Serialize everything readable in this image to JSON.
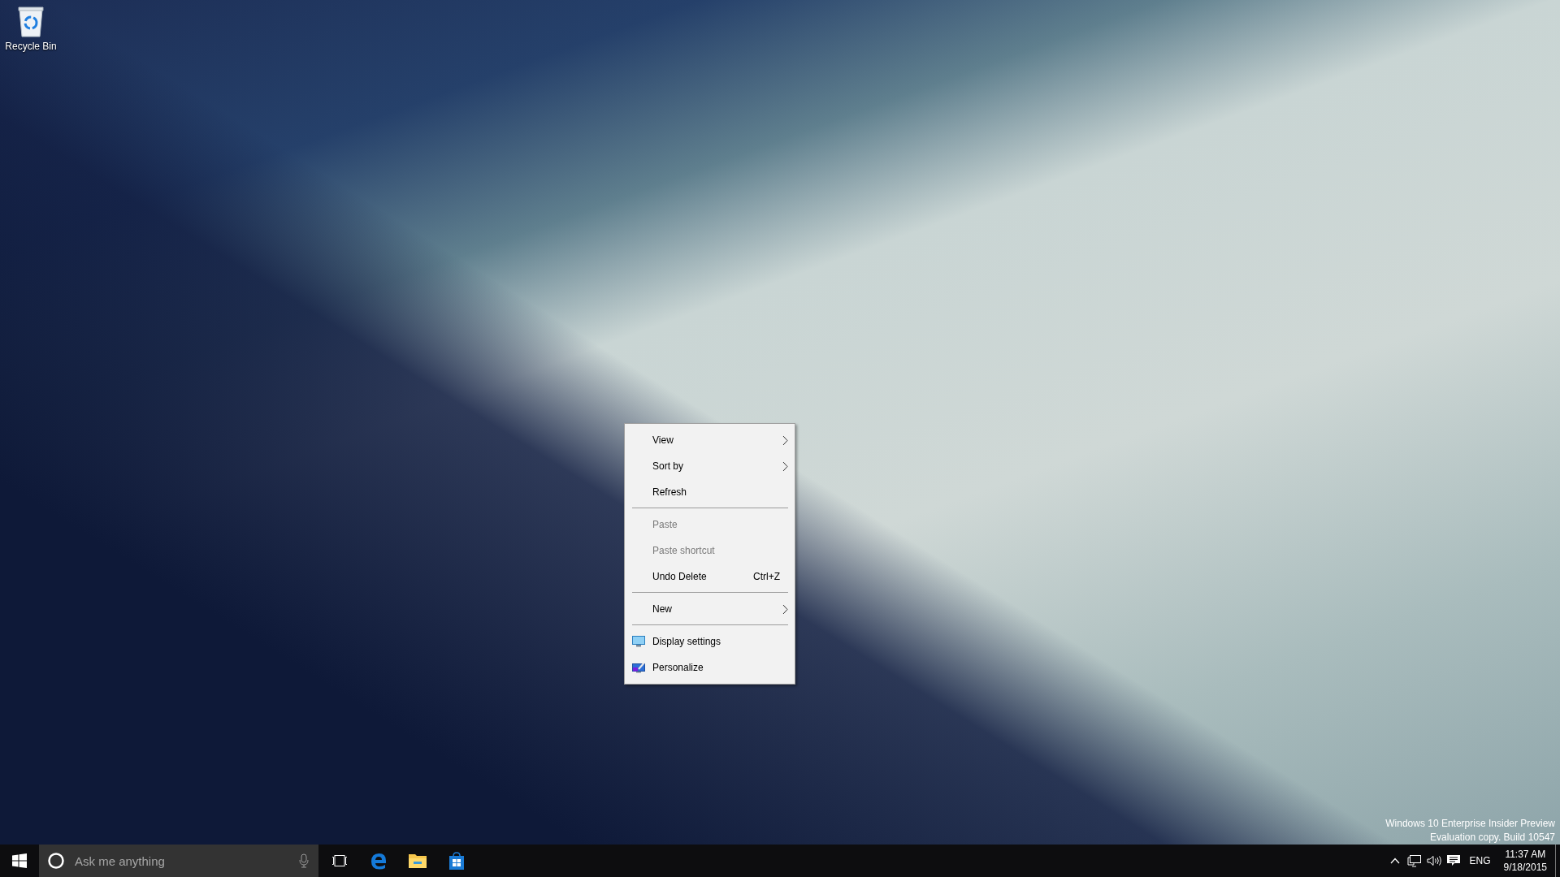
{
  "desktop": {
    "icons": [
      {
        "label": "Recycle Bin"
      }
    ]
  },
  "context_menu": {
    "items": [
      {
        "kind": "command",
        "label": "View",
        "disabled": false,
        "submenu": true
      },
      {
        "kind": "command",
        "label": "Sort by",
        "disabled": false,
        "submenu": true
      },
      {
        "kind": "command",
        "label": "Refresh",
        "disabled": false,
        "submenu": false
      },
      {
        "kind": "separator"
      },
      {
        "kind": "command",
        "label": "Paste",
        "disabled": true,
        "submenu": false
      },
      {
        "kind": "command",
        "label": "Paste shortcut",
        "disabled": true,
        "submenu": false
      },
      {
        "kind": "command",
        "label": "Undo Delete",
        "disabled": false,
        "submenu": false,
        "shortcut": "Ctrl+Z"
      },
      {
        "kind": "separator"
      },
      {
        "kind": "command",
        "label": "New",
        "disabled": false,
        "submenu": true
      },
      {
        "kind": "separator"
      },
      {
        "kind": "icon_command",
        "label": "Display settings",
        "disabled": false,
        "submenu": false
      },
      {
        "kind": "icon_command",
        "label": "Personalize",
        "disabled": false,
        "submenu": false
      }
    ]
  },
  "edition_notice": [
    "Windows 10 Enterprise Insider Preview",
    "Evaluation copy. Build 10547"
  ],
  "taskbar": {
    "search": {
      "placeholder": "Ask me anything"
    },
    "tray": {
      "language": "ENG",
      "time": "11:37 AM",
      "date": "9/18/2015"
    }
  }
}
